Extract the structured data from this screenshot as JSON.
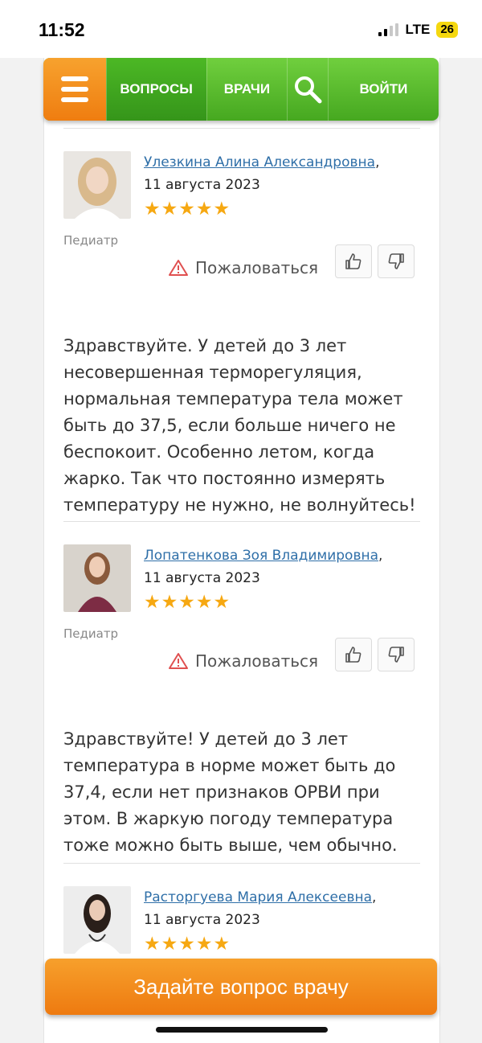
{
  "status": {
    "time": "11:52",
    "network": "LTE",
    "battery": "26"
  },
  "nav": {
    "menu_icon": "hamburger-icon",
    "questions": "ВОПРОСЫ",
    "doctors": "ВРАЧИ",
    "search_icon": "search-icon",
    "login": "ВОЙТИ"
  },
  "answers": [
    {
      "doctor": "Улезкина Алина Александровна",
      "date": "11 августа 2023",
      "rating": 5,
      "specialty": "Педиатр",
      "complain": "Пожаловаться",
      "text": "Здравствуйте. У детей до 3 лет несовершенная терморегуляция, нормальная температура тела может быть до 37,5, если больше ничего не беспокоит. Особенно летом, когда жарко. Так что постоянно измерять температуру не нужно, не волнуйтесь!"
    },
    {
      "doctor": "Лопатенкова Зоя Владимировна",
      "date": "11 августа 2023",
      "rating": 5,
      "specialty": "Педиатр",
      "complain": "Пожаловаться",
      "text": "Здравствуйте! У детей до 3 лет температура в норме может быть до 37,4, если нет признаков ОРВИ при этом. В жаркую погоду температура тоже можно быть выше, чем обычно."
    },
    {
      "doctor": "Расторгуева Мария Алексеевна",
      "date": "11 августа 2023",
      "rating": 5
    }
  ],
  "cta": {
    "label": "Задайте вопрос врачу"
  },
  "colors": {
    "nav_green": "#46a820",
    "menu_orange": "#ef7d10",
    "link_blue": "#2f6fa8",
    "star": "#f6a812"
  }
}
